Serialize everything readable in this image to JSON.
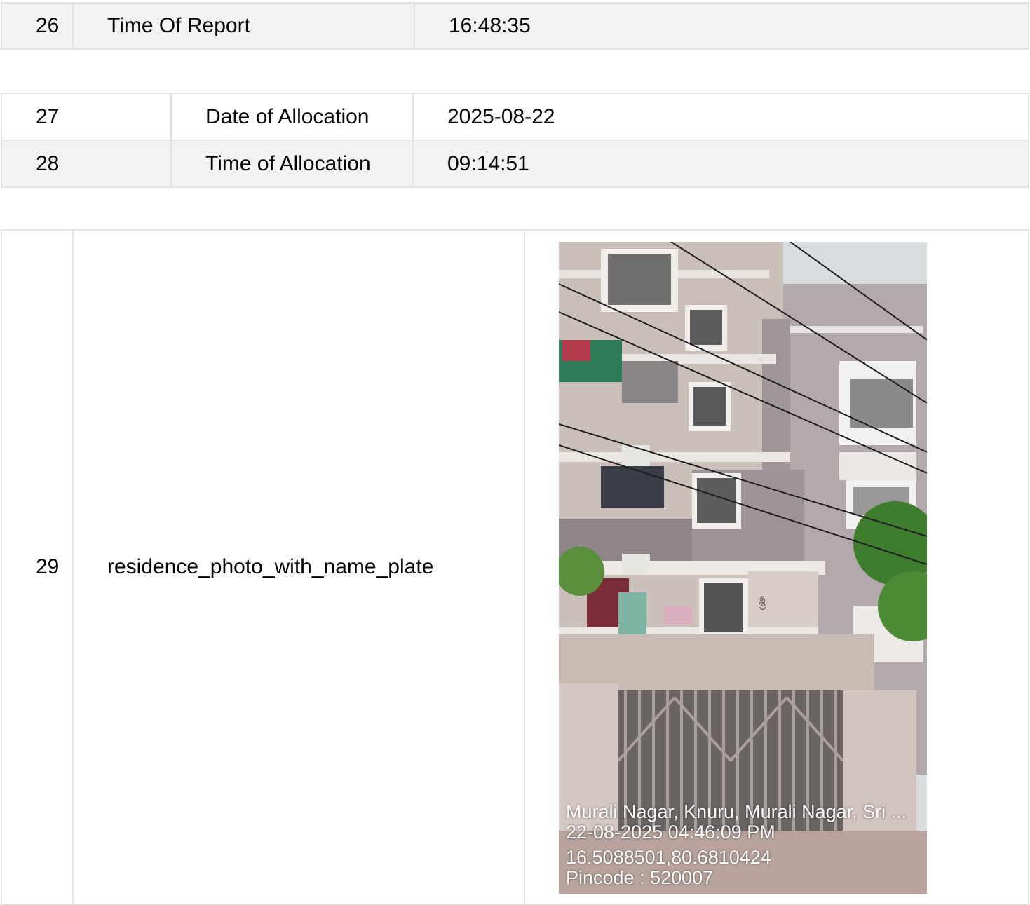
{
  "rows_top": [
    {
      "num": "26",
      "label": "Time Of Report",
      "value": "16:48:35"
    }
  ],
  "rows_mid": [
    {
      "num": "27",
      "label": "Date of Allocation",
      "value": "2025-08-22"
    },
    {
      "num": "28",
      "label": "Time of Allocation",
      "value": "09:14:51"
    }
  ],
  "row_photo": {
    "num": "29",
    "label": "residence_photo_with_name_plate",
    "overlay": {
      "address": "Murali Nagar, Knuru, Murali Nagar, Sri ...",
      "datetime": "22-08-2025 04:46:09 PM",
      "coords": "16.5088501,80.6810424",
      "pincode": "Pincode : 520007"
    }
  }
}
